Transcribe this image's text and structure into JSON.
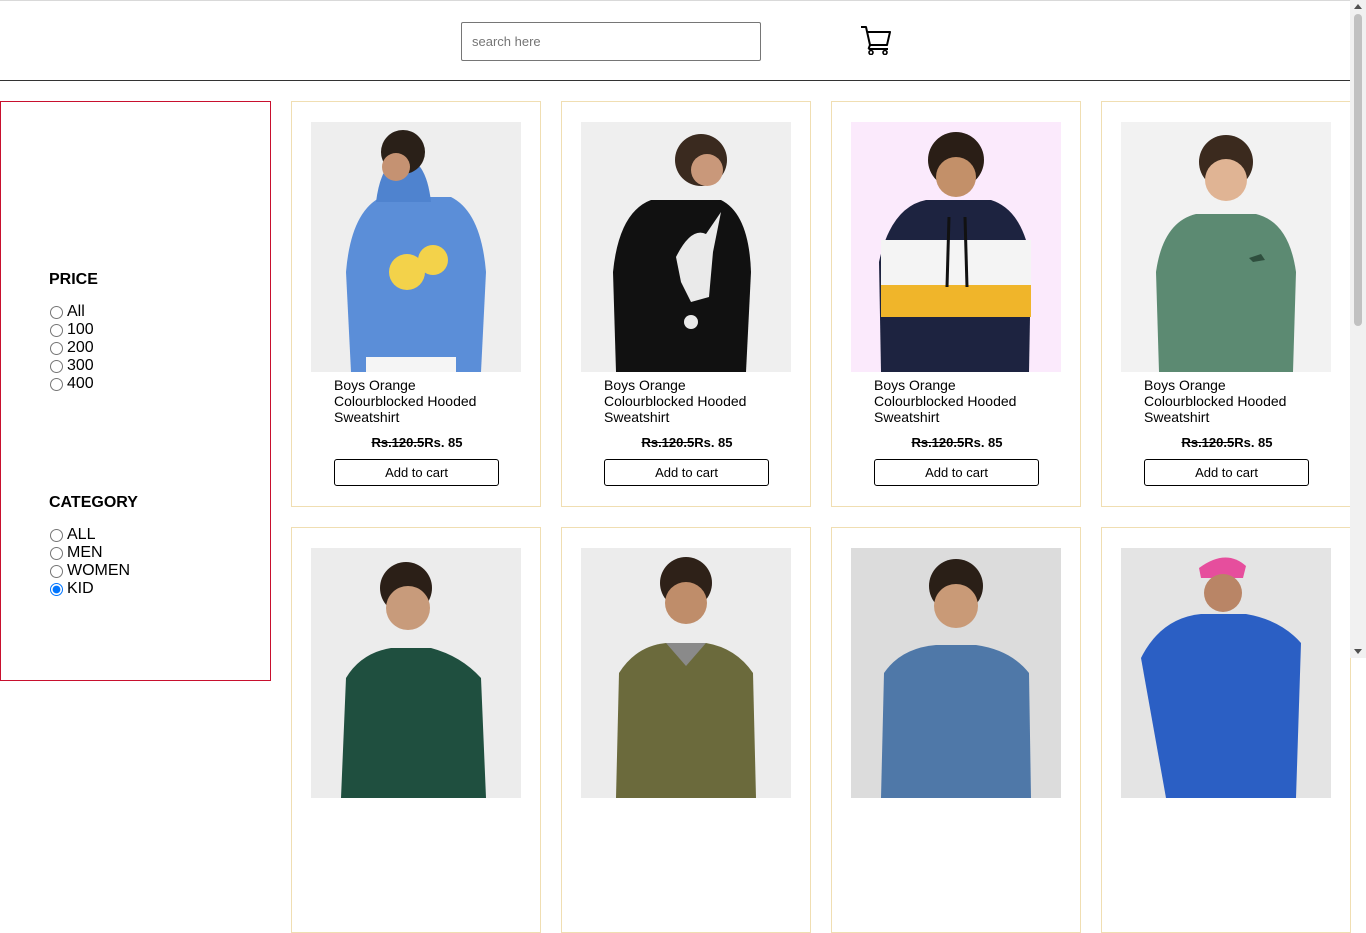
{
  "search": {
    "placeholder": "search here"
  },
  "icons": {
    "cart": "shopping-cart-icon"
  },
  "filters": {
    "price": {
      "title": "PRICE",
      "options": [
        "All",
        "100",
        "200",
        "300",
        "400"
      ],
      "selected": null
    },
    "category": {
      "title": "CATEGORY",
      "options": [
        "ALL",
        "MEN",
        "WOMEN",
        "KID"
      ],
      "selected": "KID"
    }
  },
  "products": [
    {
      "name": "Boys Orange Colourblocked Hooded Sweatshirt",
      "old_price": "Rs.120.5",
      "price": "Rs. 85",
      "button": "Add to cart"
    },
    {
      "name": "Boys Orange Colourblocked Hooded Sweatshirt",
      "old_price": "Rs.120.5",
      "price": "Rs. 85",
      "button": "Add to cart"
    },
    {
      "name": "Boys Orange Colourblocked Hooded Sweatshirt",
      "old_price": "Rs.120.5",
      "price": "Rs. 85",
      "button": "Add to cart"
    },
    {
      "name": "Boys Orange Colourblocked Hooded Sweatshirt",
      "old_price": "Rs.120.5",
      "price": "Rs. 85",
      "button": "Add to cart"
    }
  ],
  "colors": {
    "sidebar_border": "#c8102e",
    "card_border": "#f0deb2",
    "radio_checked": "#0075ff"
  }
}
